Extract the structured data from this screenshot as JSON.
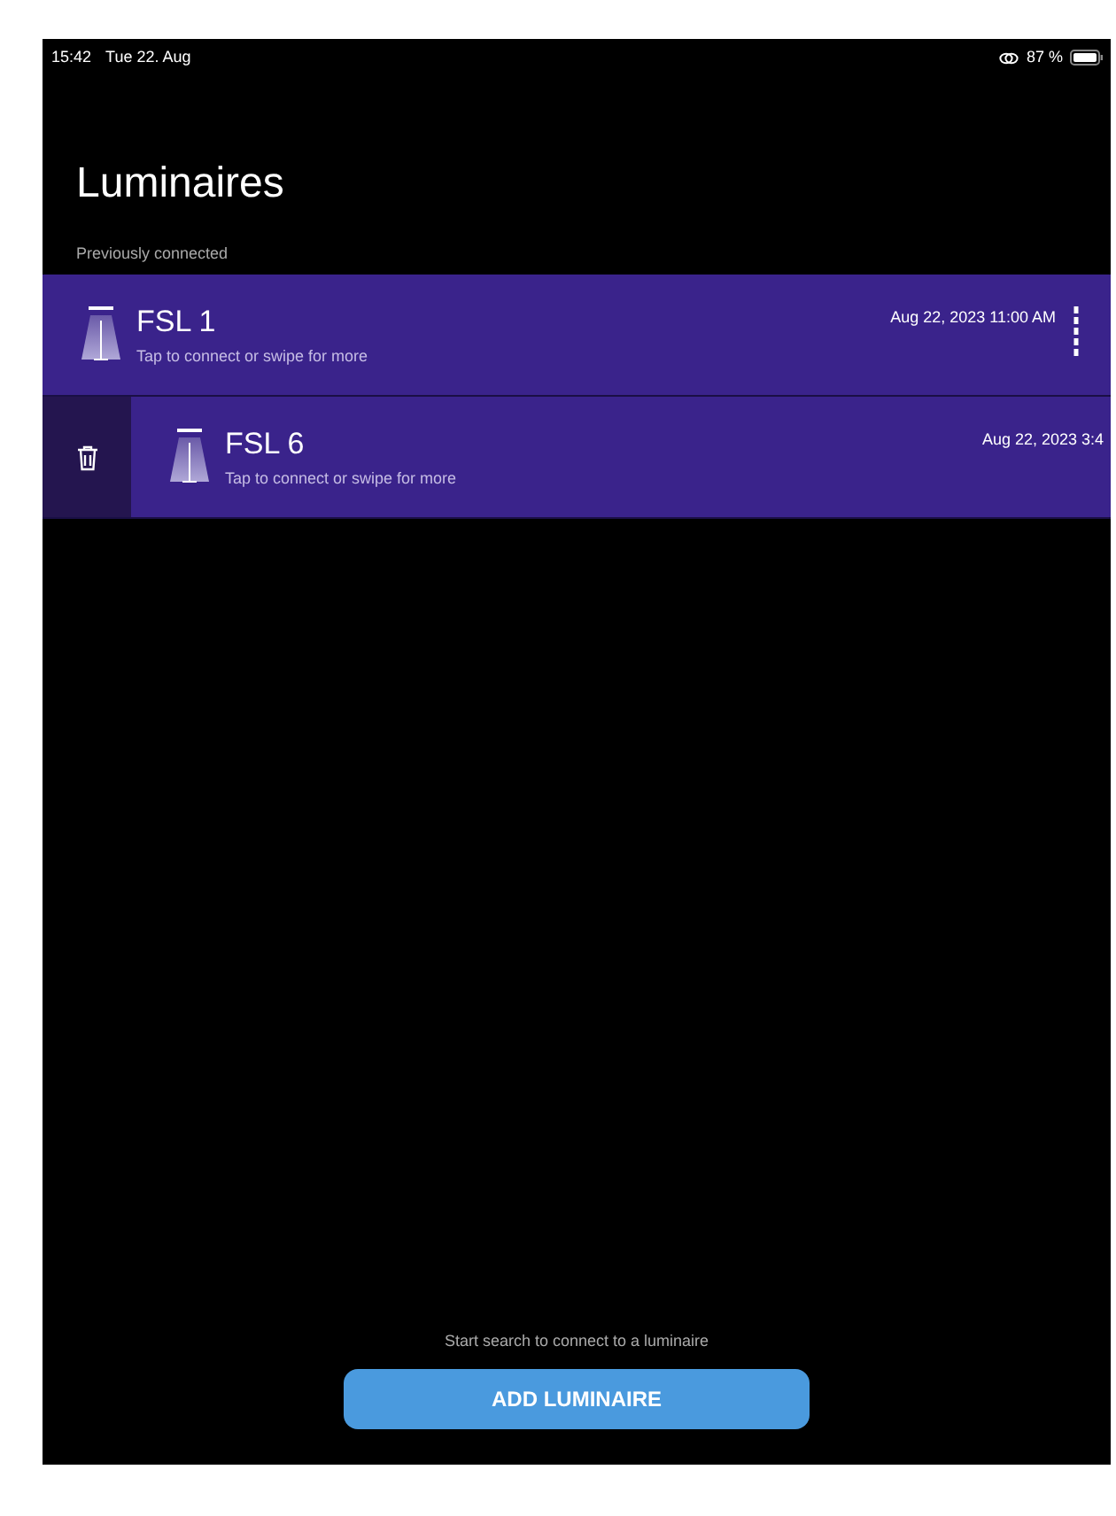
{
  "status_bar": {
    "time": "15:42",
    "date": "Tue 22. Aug",
    "battery": "87 %"
  },
  "title": "Luminaires",
  "section_label": "Previously connected",
  "luminaires": [
    {
      "name": "FSL 1",
      "hint": "Tap to connect or swipe for more",
      "timestamp": "Aug 22, 2023 11:00 AM",
      "swiped": false
    },
    {
      "name": "FSL 6",
      "hint": "Tap to connect or swipe for more",
      "timestamp": "Aug 22, 2023 3:4",
      "swiped": true
    }
  ],
  "footer_hint": "Start search to connect to a luminaire",
  "add_button": "ADD LUMINAIRE"
}
